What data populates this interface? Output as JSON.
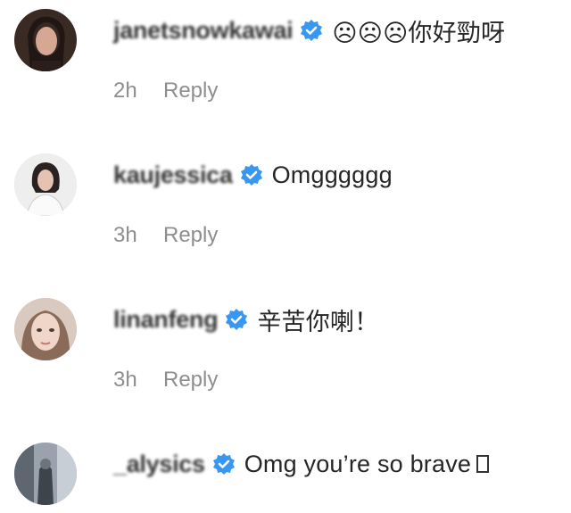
{
  "comments": [
    {
      "username": "janetsnowkawai",
      "text": "☹☹☹你好勁呀",
      "time": "2h",
      "reply": "Reply"
    },
    {
      "username": "kaujessica",
      "text": "Omgggggg",
      "time": "3h",
      "reply": "Reply"
    },
    {
      "username": "linanfeng",
      "text": "辛苦你喇！",
      "time": "3h",
      "reply": "Reply"
    },
    {
      "username": "_alysics",
      "text": "Omg you’re so brave",
      "time": "",
      "reply": ""
    }
  ],
  "colors": {
    "verified_badge": "#3897f0",
    "meta_text": "#8e8e8e",
    "username": "#262626"
  },
  "icons": {
    "verified": "verified-badge-icon"
  }
}
